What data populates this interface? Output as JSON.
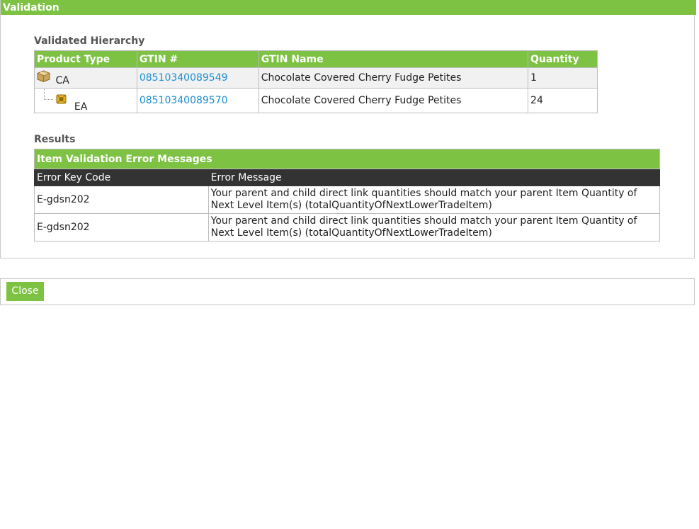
{
  "window": {
    "title": "Validation"
  },
  "hierarchy": {
    "label": "Validated Hierarchy",
    "columns": [
      "Product Type",
      "GTIN #",
      "GTIN Name",
      "Quantity"
    ],
    "rows": [
      {
        "type": "CA",
        "icon": "package-icon",
        "gtin": "08510340089549",
        "name": "Chocolate Covered Cherry Fudge Petites",
        "quantity": "1"
      },
      {
        "type": "EA",
        "icon": "each-item-icon",
        "gtin": "08510340089570",
        "name": "Chocolate Covered Cherry Fudge Petites",
        "quantity": "24"
      }
    ]
  },
  "results": {
    "label": "Results",
    "table_title": "Item Validation Error Messages",
    "columns": [
      "Error Key Code",
      "Error Message"
    ],
    "rows": [
      {
        "code": "E-gdsn202",
        "message": "Your parent and child direct link quantities should match your parent Item Quantity of Next Level Item(s) (totalQuantityOfNextLowerTradeItem)"
      },
      {
        "code": "E-gdsn202",
        "message": "Your parent and child direct link quantities should match your parent Item Quantity of Next Level Item(s) (totalQuantityOfNextLowerTradeItem)"
      }
    ]
  },
  "footer": {
    "close_label": "Close"
  },
  "colors": {
    "accent": "#7dc242",
    "link": "#1a8fd0",
    "header_dark": "#333333"
  }
}
